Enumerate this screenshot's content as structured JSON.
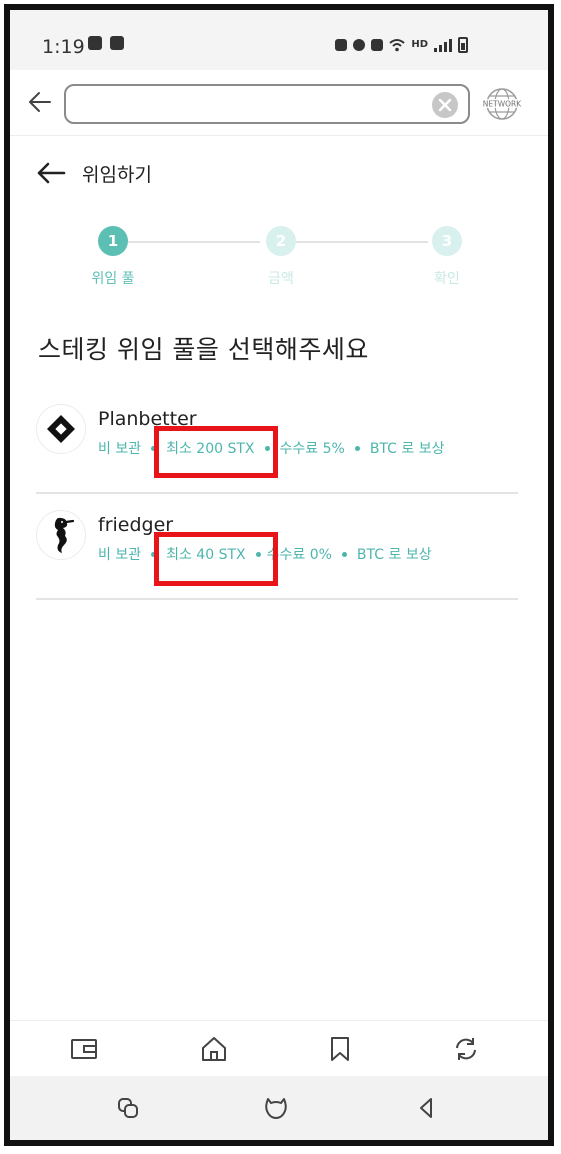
{
  "status_bar": {
    "time": "1:19",
    "network_type": "HD"
  },
  "browser": {
    "url_value": "",
    "network_label": "NETWORK"
  },
  "header": {
    "title": "위임하기"
  },
  "stepper": {
    "steps": [
      {
        "number": "1",
        "label": "위임 풀",
        "active": true
      },
      {
        "number": "2",
        "label": "금액",
        "active": false
      },
      {
        "number": "3",
        "label": "확인",
        "active": false
      }
    ],
    "active_color": "#5bbfb3",
    "inactive_color": "#d8f0ee"
  },
  "section_title": "스테킹 위임 풀을 선택해주세요",
  "pools": [
    {
      "name": "Planbetter",
      "custody": "비 보관",
      "minimum": "최소 200 STX",
      "fee": "수수료 5%",
      "reward": "BTC 로 보상",
      "logo_icon": "diamond-icon"
    },
    {
      "name": "friedger",
      "custody": "비 보관",
      "minimum": "최소 40 STX",
      "fee": "수수료 0%",
      "reward": "BTC 로 보상",
      "logo_icon": "seahorse-icon"
    }
  ],
  "colors": {
    "accent": "#4db6ac",
    "highlight": "#e8141a"
  },
  "bottom_nav": [
    "wallet-icon",
    "home-icon",
    "bookmark-icon",
    "swap-icon"
  ],
  "system_nav": [
    "recent-apps-icon",
    "home-icon",
    "back-icon"
  ]
}
